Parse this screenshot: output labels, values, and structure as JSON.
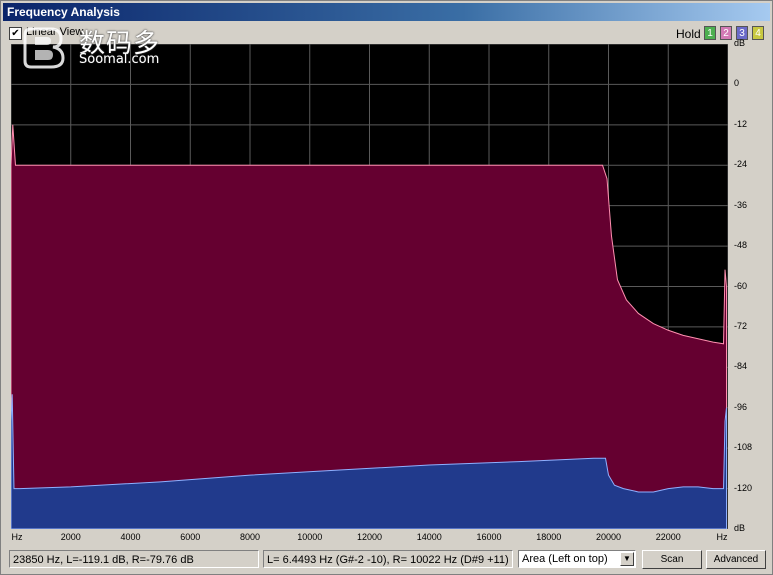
{
  "window": {
    "title": "Frequency Analysis"
  },
  "controls": {
    "linear_view": {
      "label": "Linear View",
      "checked": true
    },
    "hold_label": "Hold",
    "hold_buttons": [
      {
        "label": "1",
        "color": "#4caf50"
      },
      {
        "label": "2",
        "color": "#d27ab4"
      },
      {
        "label": "3",
        "color": "#6a6ac8"
      },
      {
        "label": "4",
        "color": "#c8c840"
      }
    ]
  },
  "watermark": {
    "chinese": "数码多",
    "site": "Soomal.com"
  },
  "chart_data": {
    "type": "area",
    "xlabel": "Hz",
    "ylabel": "dB",
    "xlim": [
      0,
      24000
    ],
    "ylim": [
      -132,
      12
    ],
    "x_ticks": [
      "Hz",
      "2000",
      "4000",
      "6000",
      "8000",
      "10000",
      "12000",
      "14000",
      "16000",
      "18000",
      "20000",
      "22000",
      "Hz"
    ],
    "y_ticks": [
      "dB",
      "0",
      "-12",
      "-24",
      "-36",
      "-48",
      "-60",
      "-72",
      "-84",
      "-96",
      "-108",
      "-120",
      "dB"
    ],
    "grid": true,
    "series": [
      {
        "name": "L",
        "color": "#650030",
        "edge": "#ff8fb0",
        "x": [
          0,
          60,
          150,
          300,
          5000,
          10000,
          15000,
          19800,
          19950,
          20100,
          20300,
          20600,
          21000,
          21500,
          22000,
          22500,
          23000,
          23500,
          23850,
          23900,
          23950
        ],
        "values": [
          -24,
          -12,
          -24,
          -24,
          -24,
          -24,
          -24,
          -24,
          -28,
          -45,
          -58,
          -64,
          -68,
          -71,
          -73,
          -74.5,
          -75.5,
          -76.5,
          -77,
          -55,
          -60
        ]
      },
      {
        "name": "R",
        "color": "#213a8c",
        "edge": "#8fb0ff",
        "x": [
          0,
          40,
          100,
          300,
          2000,
          5000,
          8000,
          11000,
          14000,
          17000,
          19500,
          19900,
          20000,
          20200,
          20500,
          21000,
          21500,
          22000,
          22500,
          23000,
          23500,
          23850,
          23900,
          23950
        ],
        "values": [
          -100,
          -92,
          -120,
          -120,
          -119.5,
          -118,
          -116,
          -114.5,
          -113,
          -112,
          -111,
          -111,
          -116,
          -119,
          -120,
          -121,
          -121,
          -120,
          -119.5,
          -119.5,
          -120,
          -120,
          -100,
          -96
        ]
      }
    ]
  },
  "status": {
    "cursor_readout": "23850 Hz, L=-119.1 dB, R=-79.76 dB",
    "peak_readout": "L= 6.4493 Hz (G#-2 -10), R= 10022 Hz (D#9 +11)"
  },
  "display_mode": {
    "value": "Area (Left on top)"
  },
  "buttons": {
    "scan": "Scan",
    "advanced": "Advanced"
  }
}
